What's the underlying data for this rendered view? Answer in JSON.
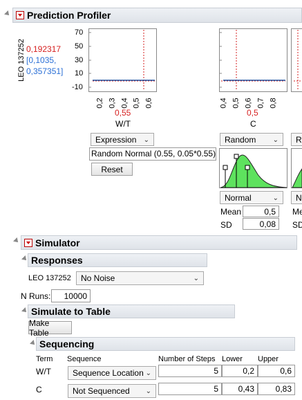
{
  "profiler": {
    "title": "Prediction Profiler",
    "response_name": "LEO 137252",
    "predicted": "0,192317",
    "ci_line1": "[0,1035,",
    "ci_line2": "0,357351]",
    "y_ticks": [
      "70",
      "50",
      "30",
      "10",
      "-10"
    ],
    "factors": [
      {
        "name": "W/T",
        "current": "0,55",
        "x_ticks": [
          "0,2",
          "0,3",
          "0,4",
          "0,5",
          "0,6"
        ],
        "dist_select": "Expression",
        "expression": "Random Normal (0.55, 0.05*0.55);",
        "reset_label": "Reset"
      },
      {
        "name": "C",
        "current": "0,5",
        "x_ticks": [
          "0,4",
          "0,5",
          "0,6",
          "0,7",
          "0,8"
        ],
        "dist_select": "Random",
        "dist_type": "Normal",
        "mean_label": "Mean",
        "mean_value": "0,5",
        "sd_label": "SD",
        "sd_value": "0,08"
      },
      {
        "dist_select": "Ra",
        "dist_type": "N",
        "mean_label": "Me",
        "sd_label": "SD"
      }
    ]
  },
  "simulator": {
    "title": "Simulator",
    "responses_title": "Responses",
    "response_name": "LEO 137252",
    "noise_select": "No Noise",
    "nruns_label": "N Runs:",
    "nruns_value": "10000",
    "sim_table_title": "Simulate to Table",
    "make_table_label": "Make Table",
    "sequencing_title": "Sequencing",
    "columns": {
      "term": "Term",
      "sequence": "Sequence",
      "steps": "Number of Steps",
      "lower": "Lower",
      "upper": "Upper"
    },
    "rows": [
      {
        "term": "W/T",
        "sequence": "Sequence Location",
        "steps": "5",
        "lower": "0,2",
        "upper": "0,6"
      },
      {
        "term": "C",
        "sequence": "Not Sequenced",
        "steps": "5",
        "lower": "0,43",
        "upper": "0,83"
      }
    ]
  },
  "colors": {
    "current_red": "#d62020",
    "ci_blue": "#2a6fd6",
    "curve": "#1f4e9c",
    "density_fill": "#5ee25e"
  }
}
